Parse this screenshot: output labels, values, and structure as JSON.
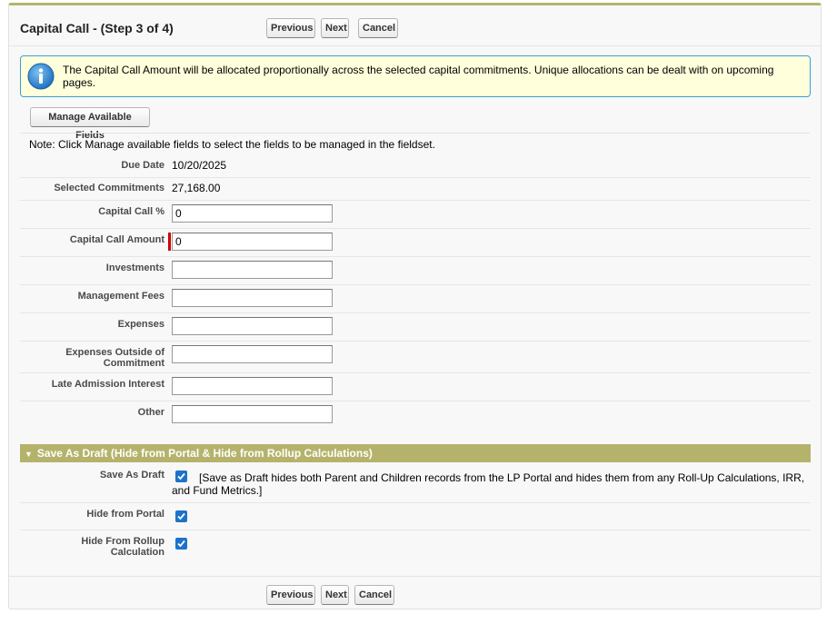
{
  "header": {
    "title": "Capital Call - (Step 3 of 4)",
    "previous_label": "Previous",
    "next_label": "Next",
    "cancel_label": "Cancel"
  },
  "info_message": "The Capital Call Amount will be allocated proportionally across the selected capital commitments. Unique allocations can be dealt with on upcoming pages.",
  "manage_fields_label": "Manage Available Fields",
  "note": "Note: Click Manage available fields to select the fields to be managed in the fieldset.",
  "fields": {
    "due_date": {
      "label": "Due Date",
      "value": "10/20/2025"
    },
    "selected_commitments": {
      "label": "Selected Commitments",
      "value": "27,168.00"
    },
    "capital_call_pct": {
      "label": "Capital Call %",
      "value": "0"
    },
    "capital_call_amount": {
      "label": "Capital Call Amount",
      "value": "0"
    },
    "investments": {
      "label": "Investments",
      "value": ""
    },
    "management_fees": {
      "label": "Management Fees",
      "value": ""
    },
    "expenses": {
      "label": "Expenses",
      "value": ""
    },
    "expenses_outside": {
      "label_line1": "Expenses Outside of",
      "label_line2": "Commitment",
      "value": ""
    },
    "late_admission": {
      "label": "Late Admission Interest",
      "value": ""
    },
    "other": {
      "label": "Other",
      "value": ""
    }
  },
  "draft_section": {
    "title": "Save As Draft (Hide from Portal & Hide from Rollup Calculations)",
    "save_as_draft": {
      "label": "Save As Draft",
      "checked": true,
      "help": "[Save as Draft hides both Parent and Children records from the LP Portal and hides them from any Roll-Up Calculations, IRR, and Fund Metrics.]"
    },
    "hide_from_portal": {
      "label": "Hide from Portal",
      "checked": true
    },
    "hide_from_rollup": {
      "label_line1": "Hide From Rollup",
      "label_line2": "Calculation",
      "checked": true
    }
  },
  "footer": {
    "previous_label": "Previous",
    "next_label": "Next",
    "cancel_label": "Cancel"
  },
  "colors": {
    "accent": "#b5b36b",
    "checkbox": "#1d73c9",
    "info_border": "#39a0d6",
    "info_bg": "#ffffdc"
  }
}
